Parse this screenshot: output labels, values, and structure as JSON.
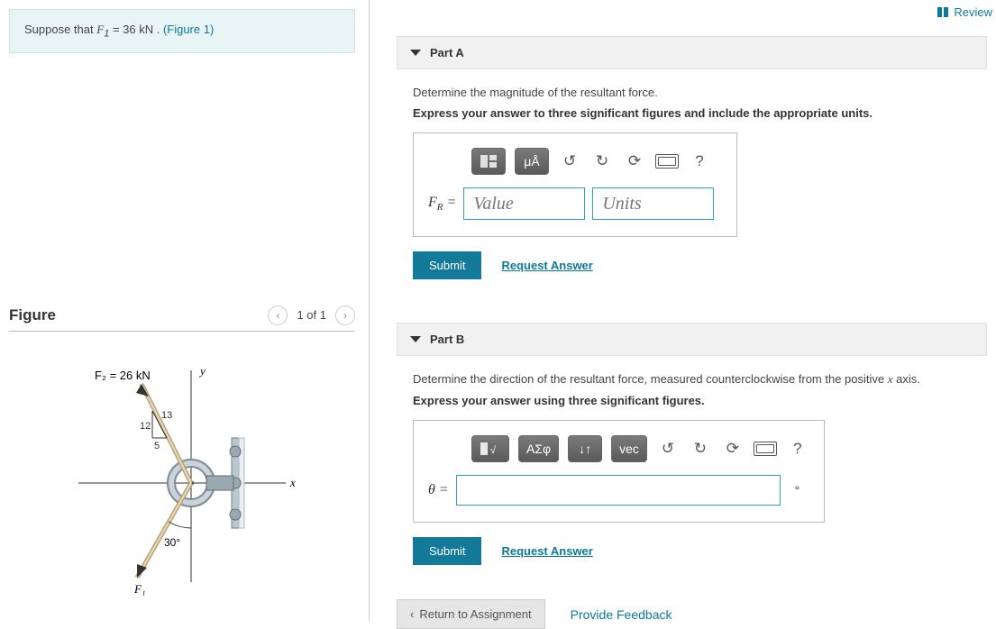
{
  "review": {
    "label": "Review"
  },
  "problem": {
    "prefix": "Suppose that ",
    "var": "F",
    "sub": "1",
    "eq": " = 36  kN . ",
    "figlink": "(Figure 1)"
  },
  "figure": {
    "title": "Figure",
    "pager_text": "1 of 1",
    "f2_label": "F₂ = 26 kN",
    "y_label": "y",
    "x_label": "x",
    "tri_12": "12",
    "tri_13": "13",
    "tri_5": "5",
    "angle": "30°",
    "f1_label": "F₁"
  },
  "partA": {
    "title": "Part A",
    "instr": "Determine the magnitude of the resultant force.",
    "bold": "Express your answer to three significant figures and include the appropriate units.",
    "toolbar": {
      "units_btn": "μÅ",
      "help": "?"
    },
    "var": "F",
    "sub": "R",
    "eq": " = ",
    "value_ph": "Value",
    "units_ph": "Units",
    "submit": "Submit",
    "request": "Request Answer"
  },
  "partB": {
    "title": "Part B",
    "instr_pre": "Determine the direction of the resultant force, measured counterclockwise from the positive ",
    "axis_var": "x",
    "instr_post": " axis.",
    "bold": "Express your answer using three significant figures.",
    "toolbar": {
      "greek": "ΑΣφ",
      "arrows": "↓↑",
      "vec": "vec",
      "help": "?"
    },
    "var": "θ",
    "eq": " = ",
    "degree": "°",
    "submit": "Submit",
    "request": "Request Answer"
  },
  "bottom": {
    "return": "Return to Assignment",
    "feedback": "Provide Feedback"
  }
}
